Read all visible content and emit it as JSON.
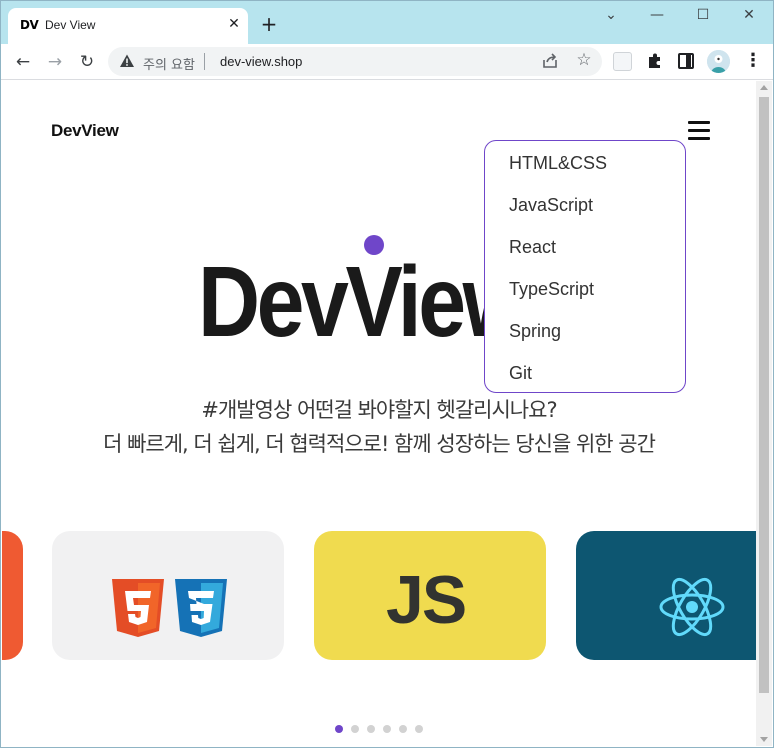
{
  "browser": {
    "tab": {
      "favicon_text": "DV",
      "title": "Dev View",
      "close_glyph": "✕"
    },
    "new_tab_glyph": "+",
    "window_controls": {
      "tab_search_glyph": "⌄",
      "minimize_glyph": "—",
      "maximize_glyph": "☐",
      "close_glyph": "✕"
    },
    "nav": {
      "back_glyph": "←",
      "forward_glyph": "→",
      "reload_glyph": "↻"
    },
    "omnibox": {
      "security_text": "주의 요함",
      "url": "dev-view.shop",
      "star_glyph": "☆"
    },
    "menu_glyph": "⋮",
    "icons": [
      "tab-search-icon",
      "minimize-icon",
      "maximize-icon",
      "close-icon",
      "back-arrow-icon",
      "forward-arrow-icon",
      "reload-icon",
      "warning-icon",
      "share-icon",
      "star-icon",
      "extension-icon",
      "puzzle-icon",
      "side-panel-icon",
      "avatar",
      "kebab-menu-icon"
    ]
  },
  "site": {
    "logo": "DevView",
    "hero_title": "DevView",
    "subtitle_line1": "#개발영상 어떤걸 봐야할지 헷갈리시나요?",
    "subtitle_line2": "더 빠르게, 더 쉽게, 더 협력적으로! 함께 성장하는 당신을 위한 공간",
    "menu_items": [
      "HTML&CSS",
      "JavaScript",
      "React",
      "TypeScript",
      "Spring",
      "Git"
    ],
    "cards": [
      {
        "name": "partial-card",
        "icon": "partial"
      },
      {
        "name": "html-css",
        "icon": "html5-css3-logo"
      },
      {
        "name": "javascript",
        "icon": "js-logo",
        "text": "JS"
      },
      {
        "name": "react",
        "icon": "react-logo"
      }
    ],
    "pager": {
      "count": 6,
      "active_index": 0
    }
  },
  "colors": {
    "accent": "#6f46c9",
    "titlebar": "#b7e4ee",
    "html5": "#e44d26",
    "css3": "#1572b6",
    "js_bg": "#f0db4f",
    "react_bg": "#0d5671",
    "react_logo": "#61dafb",
    "partial_card": "#ef5a32"
  }
}
